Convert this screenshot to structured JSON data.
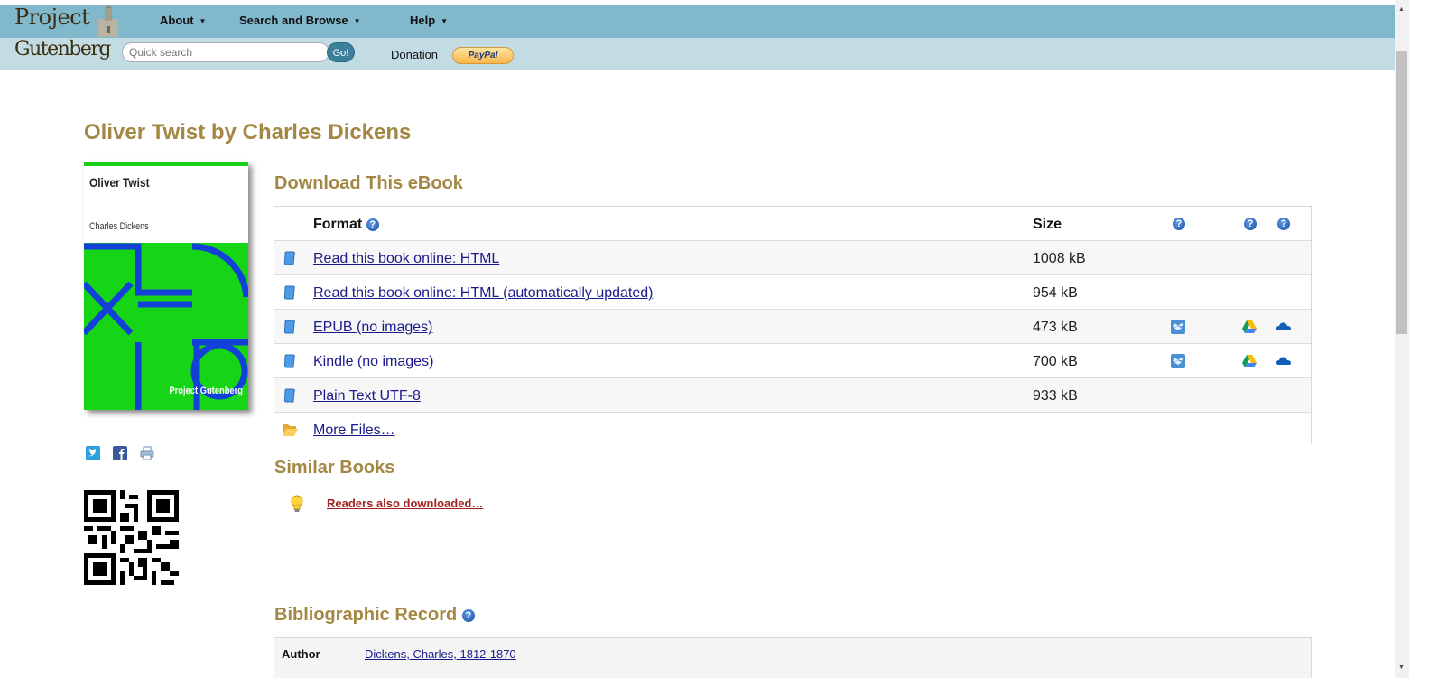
{
  "logo": {
    "line1": "Project",
    "line2": "Gutenberg"
  },
  "nav": {
    "about": "About",
    "search": "Search and Browse",
    "help": "Help",
    "caret": "▼"
  },
  "search": {
    "placeholder": "Quick search",
    "go": "Go!"
  },
  "donation": {
    "label": "Donation",
    "paypal": "PayPal"
  },
  "page_title": "Oliver Twist by Charles Dickens",
  "cover": {
    "title": "Oliver Twist",
    "author": "Charles Dickens",
    "publisher": "Project Gutenberg"
  },
  "download": {
    "heading": "Download This eBook",
    "header": {
      "format": "Format",
      "size": "Size",
      "help": "?"
    },
    "rows": [
      {
        "format": "Read this book online: HTML",
        "size": "1008 kB",
        "icon": "book-icon",
        "services": []
      },
      {
        "format": "Read this book online: HTML (automatically updated)",
        "size": "954 kB",
        "icon": "book-icon",
        "services": []
      },
      {
        "format": "EPUB (no images)",
        "size": "473 kB",
        "icon": "book-icon",
        "services": [
          "dropbox-icon",
          "google-drive-icon",
          "onedrive-icon"
        ]
      },
      {
        "format": "Kindle (no images)",
        "size": "700 kB",
        "icon": "book-icon",
        "services": [
          "dropbox-icon",
          "google-drive-icon",
          "onedrive-icon"
        ]
      },
      {
        "format": "Plain Text UTF-8",
        "size": "933 kB",
        "icon": "book-icon",
        "services": []
      },
      {
        "format": "More Files…",
        "size": "",
        "icon": "folder-icon",
        "services": []
      }
    ]
  },
  "similar": {
    "heading": "Similar Books",
    "link": "Readers also downloaded…"
  },
  "biblio": {
    "heading": "Bibliographic Record",
    "author_label": "Author",
    "author_value": "Dickens, Charles, 1812-1870"
  },
  "colors": {
    "heading": "#a38743",
    "nav_bar": "#82b8cc",
    "sub_bar": "#c3dce4",
    "link": "#1a1a8a",
    "readers_link": "#a32222"
  }
}
